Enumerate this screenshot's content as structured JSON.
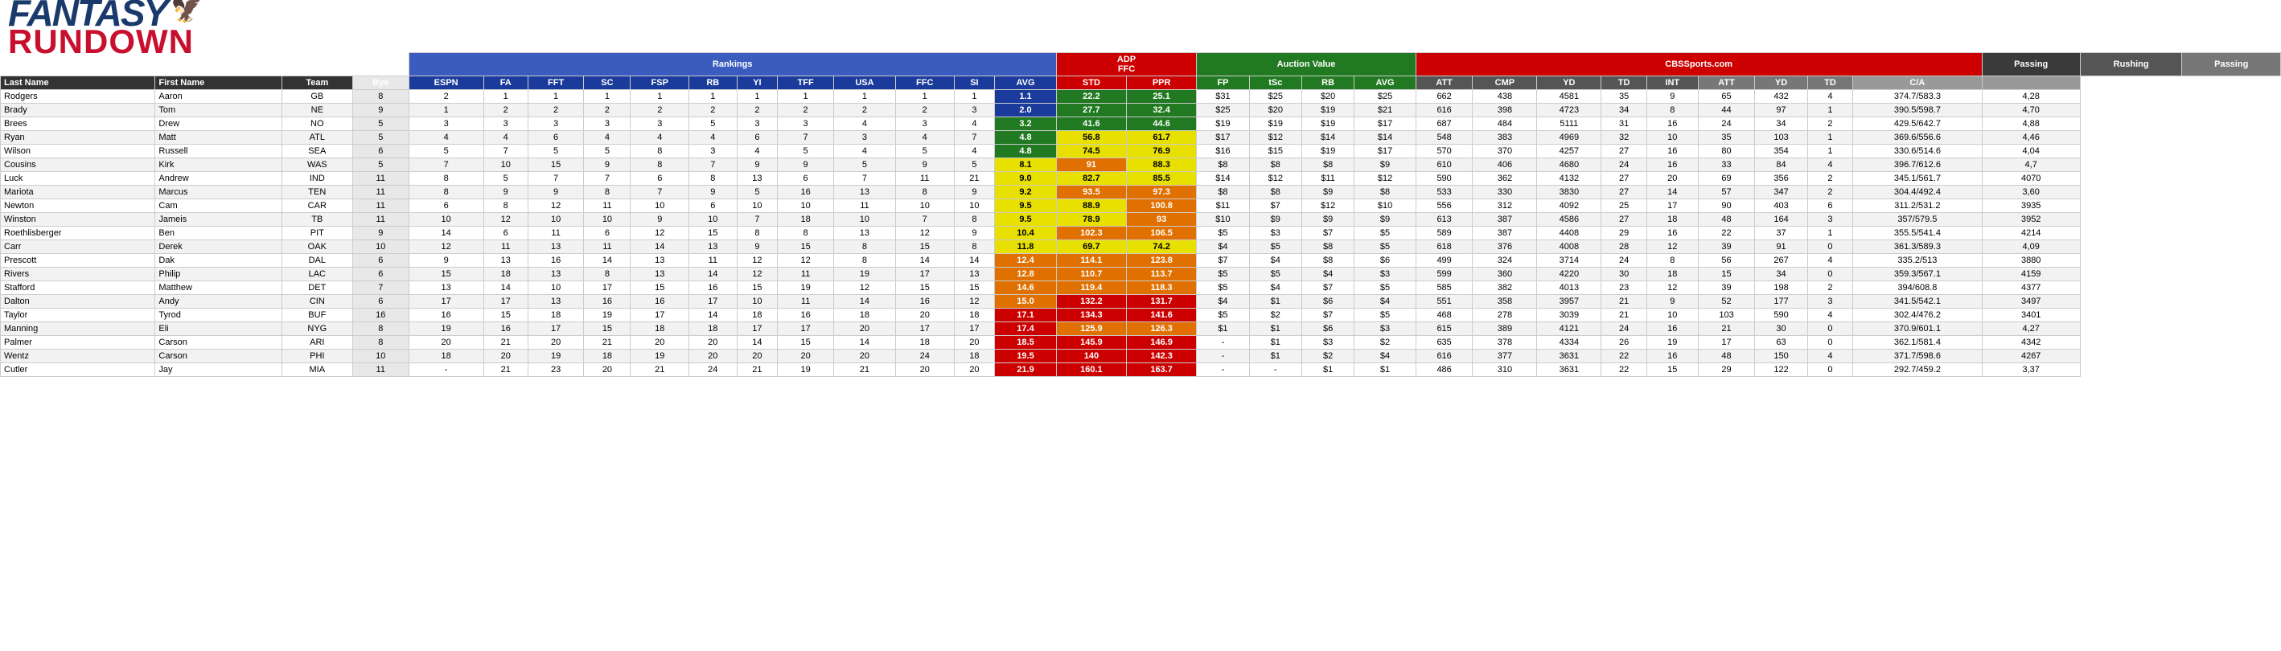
{
  "logo": {
    "fantasy": "FANTASY",
    "rundown": "RUNDOWN"
  },
  "section_labels": {
    "adp": "ADP",
    "ffc": "FFC",
    "rankings": "Rankings",
    "auction_value": "Auction Value",
    "cbssports": "CBSSports.com",
    "passing": "Passing",
    "rushing": "Rushing",
    "passing2": "Passing"
  },
  "col_headers": {
    "last_name": "Last Name",
    "first_name": "First Name",
    "team": "Team",
    "bye": "Bye",
    "espn": "ESPN",
    "fa": "FA",
    "fft": "FFT",
    "sc": "SC",
    "fsp": "FSP",
    "rb": "RB",
    "yi": "YI",
    "tff": "TFF",
    "usa": "USA",
    "ffc": "FFC",
    "si": "SI",
    "avg": "AVG",
    "std": "STD",
    "ppr": "PPR",
    "fp": "FP",
    "tsc": "tSc",
    "rb2": "RB",
    "avg2": "AVG",
    "att": "ATT",
    "cmp": "CMP",
    "yd": "YD",
    "td": "TD",
    "int": "INT",
    "att2": "ATT",
    "yd2": "YD",
    "td2": "TD",
    "ca": "C/A"
  },
  "players": [
    {
      "last": "Rodgers",
      "first": "Aaron",
      "team": "GB",
      "bye": 8,
      "espn": 2,
      "fa": 1,
      "fft": 1,
      "sc": 1,
      "fsp": 1,
      "rb": 1,
      "yi": 1,
      "tff": 1,
      "usa": 1,
      "ffc": 1,
      "si": 1,
      "avg": 1.1,
      "avg_class": "avg-blue",
      "std": 22.2,
      "ppr": 25.1,
      "fp": "$31",
      "tsc": "$25",
      "rb_a": "$20",
      "avg_a": "$25",
      "att": 662,
      "cmp": 438,
      "yd": 4581,
      "td": 35,
      "int": 9,
      "att2": 65,
      "yd2": 432,
      "td2": 4,
      "ca": "374.7/583.3",
      "ca2": "4,28"
    },
    {
      "last": "Brady",
      "first": "Tom",
      "team": "NE",
      "bye": 9,
      "espn": 1,
      "fa": 2,
      "fft": 2,
      "sc": 2,
      "fsp": 2,
      "rb": 2,
      "yi": 2,
      "tff": 2,
      "usa": 2,
      "ffc": 2,
      "si": 3,
      "avg": 2.0,
      "avg_class": "avg-blue",
      "std": 27.7,
      "ppr": 32.4,
      "fp": "$25",
      "tsc": "$20",
      "rb_a": "$19",
      "avg_a": "$21",
      "att": 616,
      "cmp": 398,
      "yd": 4723,
      "td": 34,
      "int": 8,
      "att2": 44,
      "yd2": 97,
      "td2": 1,
      "ca": "390.5/598.7",
      "ca2": "4,70"
    },
    {
      "last": "Brees",
      "first": "Drew",
      "team": "NO",
      "bye": 5,
      "espn": 3,
      "fa": 3,
      "fft": 3,
      "sc": 3,
      "fsp": 3,
      "rb": 5,
      "yi": 3,
      "tff": 3,
      "usa": 4,
      "ffc": 3,
      "si": 4,
      "avg": 3.2,
      "avg_class": "avg-blue",
      "std": 41.6,
      "ppr": 44.6,
      "fp": "$19",
      "tsc": "$19",
      "rb_a": "$19",
      "avg_a": "$17",
      "att": 687,
      "cmp": 484,
      "yd": 5111,
      "td": 31,
      "int": 16,
      "att2": 24,
      "yd2": 34,
      "td2": 2,
      "ca": "429.5/642.7",
      "ca2": "4,88"
    },
    {
      "last": "Ryan",
      "first": "Matt",
      "team": "ATL",
      "bye": 5,
      "espn": 4,
      "fa": 4,
      "fft": 6,
      "sc": 4,
      "fsp": 4,
      "rb": 4,
      "yi": 6,
      "tff": 7,
      "usa": 3,
      "ffc": 4,
      "si": 7,
      "avg": 4.8,
      "avg_class": "avg-green",
      "std": 56.8,
      "ppr": 61.7,
      "fp": "$17",
      "tsc": "$12",
      "rb_a": "$14",
      "avg_a": "$14",
      "att": 548,
      "cmp": 383,
      "yd": 4969,
      "td": 32,
      "int": 10,
      "att2": 35,
      "yd2": 103,
      "td2": 1,
      "ca": "369.6/556.6",
      "ca2": "4,46"
    },
    {
      "last": "Wilson",
      "first": "Russell",
      "team": "SEA",
      "bye": 6,
      "espn": 5,
      "fa": 7,
      "fft": 5,
      "sc": 5,
      "fsp": 8,
      "rb": 3,
      "yi": 4,
      "tff": 5,
      "usa": 4,
      "ffc": 5,
      "si": 4,
      "avg": 4.8,
      "avg_class": "avg-green",
      "std": 74.5,
      "ppr": 76.9,
      "fp": "$16",
      "tsc": "$15",
      "rb_a": "$19",
      "avg_a": "$17",
      "att": 570,
      "cmp": 370,
      "yd": 4257,
      "td": 27,
      "int": 16,
      "att2": 80,
      "yd2": 354,
      "td2": 1,
      "ca": "330.6/514.6",
      "ca2": "4,04"
    },
    {
      "last": "Cousins",
      "first": "Kirk",
      "team": "WAS",
      "bye": 5,
      "espn": 7,
      "fa": 10,
      "fft": 15,
      "sc": 9,
      "fsp": 8,
      "rb": 7,
      "yi": 9,
      "tff": 9,
      "usa": 5,
      "ffc": 9,
      "si": 5,
      "avg": 8.1,
      "avg_class": "avg-green",
      "std": 91.0,
      "ppr": 88.3,
      "fp": "$8",
      "tsc": "$8",
      "rb_a": "$8",
      "avg_a": "$9",
      "att": 610,
      "cmp": 406,
      "yd": 4680,
      "td": 24,
      "int": 16,
      "att2": 33,
      "yd2": 84,
      "td2": 4,
      "ca": "396.7/612.6",
      "ca2": "4,7"
    },
    {
      "last": "Luck",
      "first": "Andrew",
      "team": "IND",
      "bye": 11,
      "espn": 8,
      "fa": 5,
      "fft": 7,
      "sc": 7,
      "fsp": 6,
      "rb": 8,
      "yi": 13,
      "tff": 6,
      "usa": 7,
      "ffc": 11,
      "si": 21,
      "avg": 9.0,
      "avg_class": "avg-green",
      "std": 82.7,
      "ppr": 85.5,
      "fp": "$14",
      "tsc": "$12",
      "rb_a": "$11",
      "avg_a": "$12",
      "att": 590,
      "cmp": 362,
      "yd": 4132,
      "td": 27,
      "int": 20,
      "att2": 69,
      "yd2": 356,
      "td2": 2,
      "ca": "345.1/561.7",
      "ca2": "4070"
    },
    {
      "last": "Mariota",
      "first": "Marcus",
      "team": "TEN",
      "bye": 11,
      "espn": 8,
      "fa": 9,
      "fft": 9,
      "sc": 8,
      "fsp": 7,
      "rb": 9,
      "yi": 5,
      "tff": 16,
      "usa": 13,
      "ffc": 8,
      "si": 9,
      "avg": 9.2,
      "avg_class": "avg-green",
      "std": 93.5,
      "ppr": 97.3,
      "fp": "$8",
      "tsc": "$8",
      "rb_a": "$9",
      "avg_a": "$8",
      "att": 533,
      "cmp": 330,
      "yd": 3830,
      "td": 27,
      "int": 14,
      "att2": 57,
      "yd2": 347,
      "td2": 2,
      "ca": "304.4/492.4",
      "ca2": "3,60"
    },
    {
      "last": "Newton",
      "first": "Cam",
      "team": "CAR",
      "bye": 11,
      "espn": 6,
      "fa": 8,
      "fft": 12,
      "sc": 11,
      "fsp": 10,
      "rb": 6,
      "yi": 10,
      "tff": 10,
      "usa": 11,
      "ffc": 10,
      "si": 10,
      "avg": 9.5,
      "avg_class": "avg-yellow",
      "std": 88.9,
      "ppr": 100.8,
      "fp": "$11",
      "tsc": "$7",
      "rb_a": "$12",
      "avg_a": "$10",
      "att": 556,
      "cmp": 312,
      "yd": 4092,
      "td": 25,
      "int": 17,
      "att2": 90,
      "yd2": 403,
      "td2": 6,
      "ca": "311.2/531.2",
      "ca2": "3935"
    },
    {
      "last": "Winston",
      "first": "Jameis",
      "team": "TB",
      "bye": 11,
      "espn": 10,
      "fa": 12,
      "fft": 10,
      "sc": 10,
      "fsp": 9,
      "rb": 10,
      "yi": 7,
      "tff": 18,
      "usa": 10,
      "ffc": 7,
      "si": 8,
      "avg": 9.5,
      "avg_class": "avg-yellow",
      "std": 78.9,
      "ppr": 93.0,
      "fp": "$10",
      "tsc": "$9",
      "rb_a": "$9",
      "avg_a": "$9",
      "att": 613,
      "cmp": 387,
      "yd": 4586,
      "td": 27,
      "int": 18,
      "att2": 48,
      "yd2": 164,
      "td2": 3,
      "ca": "357/579.5",
      "ca2": "3952"
    },
    {
      "last": "Roethlisberger",
      "first": "Ben",
      "team": "PIT",
      "bye": 9,
      "espn": 14,
      "fa": 6,
      "fft": 11,
      "sc": 6,
      "fsp": 12,
      "rb": 15,
      "yi": 8,
      "tff": 8,
      "usa": 13,
      "ffc": 12,
      "si": 9,
      "avg": 10.4,
      "avg_class": "avg-yellow",
      "std": 102.3,
      "ppr": 106.5,
      "fp": "$5",
      "tsc": "$3",
      "rb_a": "$7",
      "avg_a": "$5",
      "att": 589,
      "cmp": 387,
      "yd": 4408,
      "td": 29,
      "int": 16,
      "att2": 22,
      "yd2": 37,
      "td2": 1,
      "ca": "355.5/541.4",
      "ca2": "4214"
    },
    {
      "last": "Carr",
      "first": "Derek",
      "team": "OAK",
      "bye": 10,
      "espn": 12,
      "fa": 11,
      "fft": 13,
      "sc": 11,
      "fsp": 14,
      "rb": 13,
      "yi": 9,
      "tff": 15,
      "usa": 8,
      "ffc": 15,
      "si": 8,
      "avg": 11.8,
      "avg_class": "avg-yellow",
      "std": 69.7,
      "ppr": 74.2,
      "fp": "$4",
      "tsc": "$5",
      "rb_a": "$8",
      "avg_a": "$5",
      "att": 618,
      "cmp": 376,
      "yd": 4008,
      "td": 28,
      "int": 12,
      "att2": 39,
      "yd2": 91,
      "td2": 0,
      "ca": "361.3/589.3",
      "ca2": "4,09"
    },
    {
      "last": "Prescott",
      "first": "Dak",
      "team": "DAL",
      "bye": 6,
      "espn": 9,
      "fa": 13,
      "fft": 16,
      "sc": 14,
      "fsp": 13,
      "rb": 11,
      "yi": 12,
      "tff": 12,
      "usa": 8,
      "ffc": 14,
      "si": 14,
      "avg": 12.4,
      "avg_class": "avg-yellow",
      "std": 114.1,
      "ppr": 123.8,
      "fp": "$7",
      "tsc": "$4",
      "rb_a": "$8",
      "avg_a": "$6",
      "att": 499,
      "cmp": 324,
      "yd": 3714,
      "td": 24,
      "int": 8,
      "att2": 56,
      "yd2": 267,
      "td2": 4,
      "ca": "335.2/513",
      "ca2": "3880"
    },
    {
      "last": "Rivers",
      "first": "Philip",
      "team": "LAC",
      "bye": 6,
      "espn": 15,
      "fa": 18,
      "fft": 13,
      "sc": 8,
      "fsp": 13,
      "rb": 14,
      "yi": 12,
      "tff": 11,
      "usa": 19,
      "ffc": 17,
      "si": 13,
      "avg": 12.8,
      "avg_class": "avg-yellow",
      "std": 110.7,
      "ppr": 113.7,
      "fp": "$5",
      "tsc": "$5",
      "rb_a": "$4",
      "avg_a": "$3",
      "att": 599,
      "cmp": 360,
      "yd": 4220,
      "td": 30,
      "int": 18,
      "att2": 15,
      "yd2": 34,
      "td2": 0,
      "ca": "359.3/567.1",
      "ca2": "4159"
    },
    {
      "last": "Stafford",
      "first": "Matthew",
      "team": "DET",
      "bye": 7,
      "espn": 13,
      "fa": 14,
      "fft": 10,
      "sc": 17,
      "fsp": 15,
      "rb": 16,
      "yi": 15,
      "tff": 19,
      "usa": 12,
      "ffc": 15,
      "si": 15,
      "avg": 14.6,
      "avg_class": "avg-orange",
      "std": 119.4,
      "ppr": 118.3,
      "fp": "$5",
      "tsc": "$4",
      "rb_a": "$7",
      "avg_a": "$5",
      "att": 585,
      "cmp": 382,
      "yd": 4013,
      "td": 23,
      "int": 12,
      "att2": 39,
      "yd2": 198,
      "td2": 2,
      "ca": "394/608.8",
      "ca2": "4377"
    },
    {
      "last": "Dalton",
      "first": "Andy",
      "team": "CIN",
      "bye": 6,
      "espn": 17,
      "fa": 17,
      "fft": 13,
      "sc": 16,
      "fsp": 16,
      "rb": 17,
      "yi": 10,
      "tff": 11,
      "usa": 14,
      "ffc": 16,
      "si": 12,
      "avg": 15.0,
      "avg_class": "avg-orange",
      "std": 132.2,
      "ppr": 131.7,
      "fp": "$4",
      "tsc": "$1",
      "rb_a": "$6",
      "avg_a": "$4",
      "att": 551,
      "cmp": 358,
      "yd": 3957,
      "td": 21,
      "int": 9,
      "att2": 52,
      "yd2": 177,
      "td2": 3,
      "ca": "341.5/542.1",
      "ca2": "3497"
    },
    {
      "last": "Taylor",
      "first": "Tyrod",
      "team": "BUF",
      "bye": 16,
      "espn": 16,
      "fa": 15,
      "fft": 18,
      "sc": 19,
      "fsp": 17,
      "rb": 14,
      "yi": 18,
      "tff": 16,
      "usa": 18,
      "ffc": 20,
      "si": 18,
      "avg": 17.1,
      "avg_class": "avg-orange",
      "std": 134.3,
      "ppr": 141.6,
      "fp": "$5",
      "tsc": "$2",
      "rb_a": "$7",
      "avg_a": "$5",
      "att": 468,
      "cmp": 278,
      "yd": 3039,
      "td": 21,
      "int": 10,
      "att2": 103,
      "yd2": 590,
      "td2": 4,
      "ca": "302.4/476.2",
      "ca2": "3401"
    },
    {
      "last": "Manning",
      "first": "Eli",
      "team": "NYG",
      "bye": 8,
      "espn": 19,
      "fa": 16,
      "fft": 17,
      "sc": 15,
      "fsp": 18,
      "rb": 18,
      "yi": 17,
      "tff": 17,
      "usa": 20,
      "ffc": 17,
      "si": 17,
      "avg": 17.4,
      "avg_class": "avg-orange",
      "std": 125.9,
      "ppr": 126.3,
      "fp": "$1",
      "tsc": "$1",
      "rb_a": "$6",
      "avg_a": "$3",
      "att": 615,
      "cmp": 389,
      "yd": 4121,
      "td": 24,
      "int": 16,
      "att2": 21,
      "yd2": 30,
      "td2": 0,
      "ca": "370.9/601.1",
      "ca2": "4,27"
    },
    {
      "last": "Palmer",
      "first": "Carson",
      "team": "ARI",
      "bye": 8,
      "espn": 20,
      "fa": 21,
      "fft": 20,
      "sc": 21,
      "fsp": 20,
      "rb": 20,
      "yi": 14,
      "tff": 15,
      "usa": 14,
      "ffc": 18,
      "si": 20,
      "avg": 18.5,
      "avg_class": "avg-red",
      "std": 145.9,
      "ppr": 146.9,
      "fp": "-",
      "tsc": "$1",
      "rb_a": "$3",
      "avg_a": "$2",
      "att": 635,
      "cmp": 378,
      "yd": 4334,
      "td": 26,
      "int": 19,
      "att2": 17,
      "yd2": 63,
      "td2": 0,
      "ca": "362.1/581.4",
      "ca2": "4342"
    },
    {
      "last": "Wentz",
      "first": "Carson",
      "team": "PHI",
      "bye": 10,
      "espn": 18,
      "fa": 20,
      "fft": 19,
      "sc": 18,
      "fsp": 19,
      "rb": 20,
      "yi": 20,
      "tff": 20,
      "usa": 20,
      "ffc": 24,
      "si": 18,
      "avg": 19.5,
      "avg_class": "avg-red",
      "std": 140.0,
      "ppr": 142.3,
      "fp": "-",
      "tsc": "$1",
      "rb_a": "$2",
      "avg_a": "$4",
      "att": 616,
      "cmp": 377,
      "yd": 3631,
      "td": 22,
      "int": 16,
      "att2": 48,
      "yd2": 150,
      "td2": 4,
      "ca": "371.7/598.6",
      "ca2": "4267"
    },
    {
      "last": "Cutler",
      "first": "Jay",
      "team": "MIA",
      "bye": 11,
      "espn": "-",
      "fa": 21,
      "fft": 23,
      "sc": 20,
      "fsp": 21,
      "rb": 24,
      "yi": 21,
      "tff": 19,
      "usa": 21,
      "ffc": 20,
      "si": 20,
      "avg": 21.9,
      "avg_class": "avg-red",
      "std": 160.1,
      "ppr": 163.7,
      "fp": "-",
      "tsc": "-",
      "rb_a": "$1",
      "avg_a": "$1",
      "att": 486,
      "cmp": 310,
      "yd": 3631,
      "td": 22,
      "int": 15,
      "att2": 29,
      "yd2": 122,
      "td2": 0,
      "ca": "292.7/459.2",
      "ca2": "3,37"
    }
  ]
}
